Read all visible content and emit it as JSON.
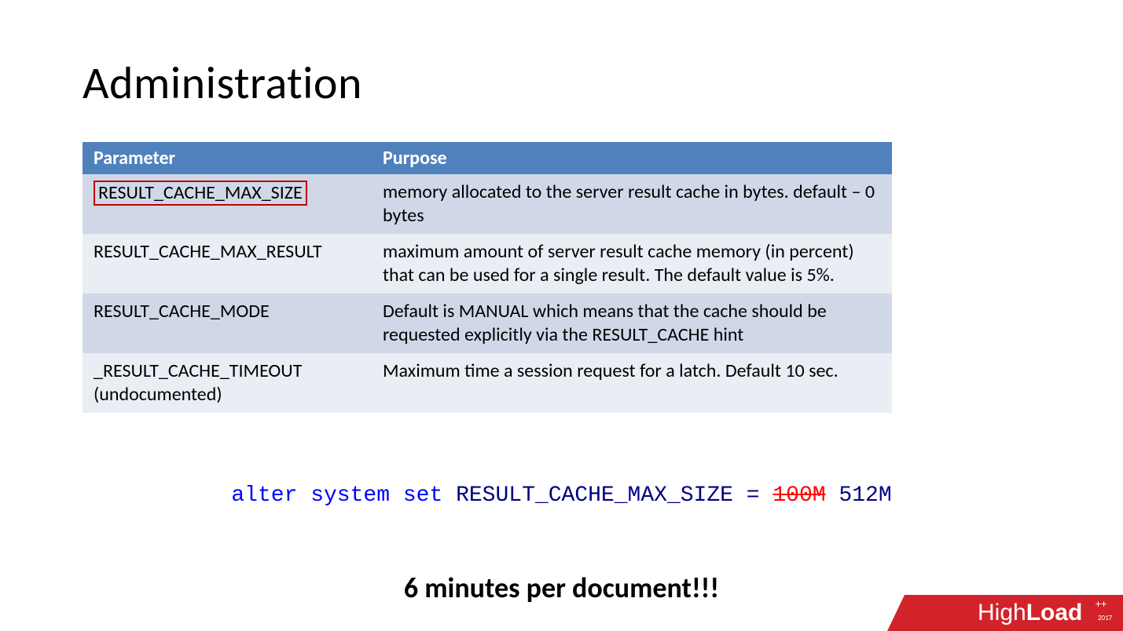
{
  "title": "Administration",
  "table": {
    "headers": {
      "param": "Parameter",
      "purpose": "Purpose"
    },
    "rows": [
      {
        "param": "RESULT_CACHE_MAX_SIZE",
        "purpose": "memory allocated to the server result cache in bytes. default – 0 bytes",
        "highlight": true
      },
      {
        "param": "RESULT_CACHE_MAX_RESULT",
        "purpose": "maximum amount of server result cache memory (in percent) that can be used for a single result. The default value is 5%."
      },
      {
        "param": "RESULT_CACHE_MODE",
        "purpose": "Default is MANUAL which means that the cache should be requested explicitly via the RESULT_CACHE hint"
      },
      {
        "param": "_RESULT_CACHE_TIMEOUT (undocumented)",
        "purpose": "Maximum time a session request for a latch. Default 10 sec."
      }
    ]
  },
  "sql": {
    "kw_alter": "alter",
    "kw_system": "system",
    "kw_set": "set",
    "param": "RESULT_CACHE_MAX_SIZE",
    "eq": "=",
    "old_val": "100M",
    "new_val": "512M"
  },
  "callout": "6 minutes per document!!!",
  "logo": {
    "high": "High",
    "load": "Load",
    "plus": "++",
    "year": "2017"
  }
}
